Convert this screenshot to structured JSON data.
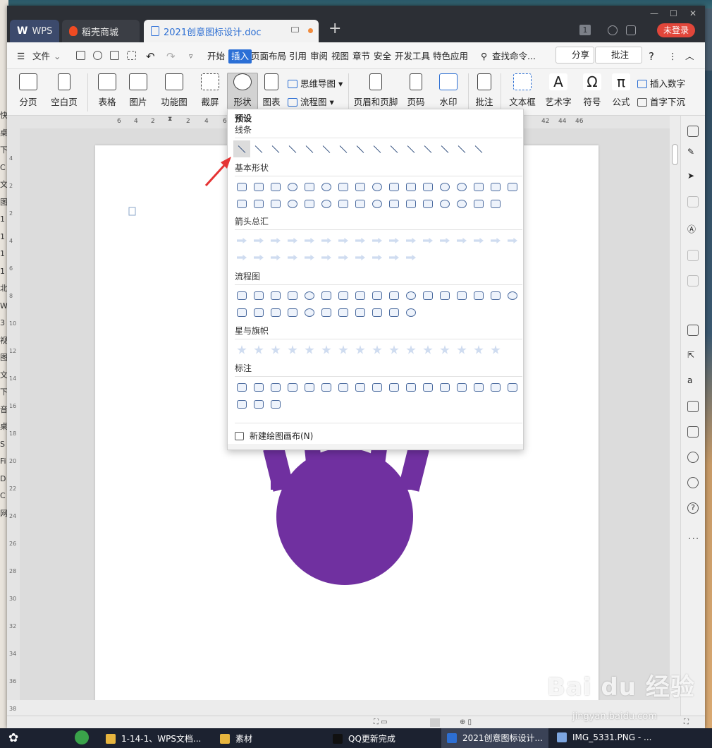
{
  "titlebar": {
    "tabs": [
      {
        "label": "WPS",
        "logo": "W"
      },
      {
        "label": "稻壳商城"
      },
      {
        "label": "2021创意图标设计.doc"
      }
    ],
    "window_badge": "1",
    "login_label": "未登录"
  },
  "menubar": {
    "file_label": "文件",
    "items": [
      "开始",
      "插入",
      "页面布局",
      "引用",
      "审阅",
      "视图",
      "章节",
      "安全",
      "开发工具",
      "特色应用"
    ],
    "active_item": "插入",
    "search_label": "查找命令...",
    "share_label": "分享",
    "comment_label": "批注",
    "help_label": "?"
  },
  "ribbon": {
    "buttons": [
      "分页",
      "空白页",
      "表格",
      "图片",
      "功能图",
      "截屏",
      "形状",
      "图表"
    ],
    "small_buttons": [
      "思维导图",
      "流程图"
    ],
    "buttons2": [
      "页眉和页脚",
      "页码",
      "水印",
      "批注",
      "文本框",
      "艺术字",
      "符号",
      "公式"
    ],
    "small_buttons2": [
      "插入数字",
      "首字下沉"
    ]
  },
  "ruler": {
    "numbers": [
      "6",
      "4",
      "2",
      "2",
      "4",
      "6",
      "42",
      "44",
      "46"
    ]
  },
  "vruler": {
    "numbers": [
      "4",
      "2",
      "2",
      "4",
      "6",
      "8",
      "10",
      "12",
      "14",
      "16",
      "18",
      "20",
      "22",
      "24",
      "26",
      "28",
      "30",
      "32",
      "34",
      "36",
      "38"
    ]
  },
  "shapes_menu": {
    "preset_label": "预设",
    "sections": [
      {
        "label": "线条",
        "count": 15
      },
      {
        "label": "基本形状",
        "count": 33
      },
      {
        "label": "箭头总汇",
        "count": 28
      },
      {
        "label": "流程图",
        "count": 28
      },
      {
        "label": "星与旗帜",
        "count": 16
      },
      {
        "label": "标注",
        "count": 20
      }
    ],
    "new_canvas_label": "新建绘图画布(N)"
  },
  "illustration": {
    "color": "#7030a0"
  },
  "desktop_left_chars": [
    "快",
    "桌",
    "下",
    "C",
    "文",
    "图",
    "1",
    "1",
    "1",
    "1",
    "北",
    "W",
    "3",
    "视",
    "图",
    "文",
    "下",
    "音",
    "桌",
    "S",
    "Fi",
    "D",
    "C",
    "网"
  ],
  "taskbar": {
    "items": [
      "1-14-1、WPS文档...",
      "素材",
      "QQ更新完成",
      "2021创意图标设计...",
      "IMG_5331.PNG - ..."
    ],
    "active_index": 3
  },
  "watermark": {
    "text": "Bai du 经验",
    "url": "jingyan.baidu.com"
  }
}
